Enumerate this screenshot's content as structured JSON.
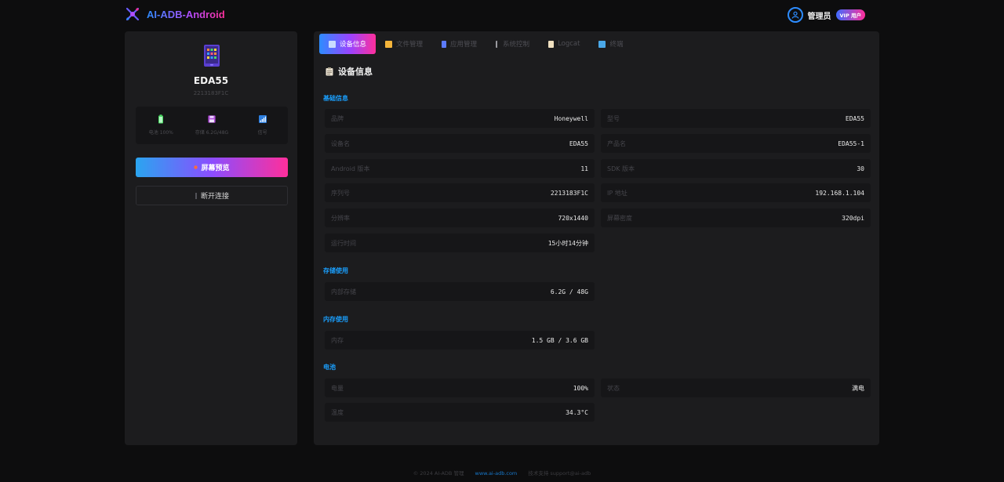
{
  "header": {
    "brand": "AI-ADB-Android",
    "user_name": "管理员",
    "vip_badge": "VIP 用户"
  },
  "device": {
    "name": "EDA55",
    "subtitle": "2213183F1C",
    "stats": [
      {
        "label": "电池 100%",
        "icon": "battery-icon",
        "color": "#4cd964"
      },
      {
        "label": "存储 6.2G/48G",
        "icon": "floppy-icon",
        "color": "#d37bff"
      },
      {
        "label": "信号",
        "icon": "signal-icon",
        "color": "#3aa0ff"
      }
    ],
    "preview_button": "屏幕预览",
    "disconnect_button": "断开连接"
  },
  "tabs": [
    {
      "label": "设备信息",
      "active": true,
      "icon_color": "#7fb6ff"
    },
    {
      "label": "文件管理",
      "active": false,
      "icon_color": "#f5b53b"
    },
    {
      "label": "应用管理",
      "active": false,
      "icon_color": "#5c7bff"
    },
    {
      "label": "系统控制",
      "active": false,
      "icon_color": "#bbbbbb"
    },
    {
      "label": "Logcat",
      "active": false,
      "icon_color": "#f0e0c0"
    },
    {
      "label": "终端",
      "active": false,
      "icon_color": "#4aa8e8"
    }
  ],
  "panel_title": "设备信息",
  "sections": {
    "basic": {
      "title": "基础信息",
      "rows": [
        {
          "key": "品牌",
          "value": "Honeywell"
        },
        {
          "key": "型号",
          "value": "EDA55"
        },
        {
          "key": "设备名",
          "value": "EDA55"
        },
        {
          "key": "产品名",
          "value": "EDA55-1"
        },
        {
          "key": "Android 版本",
          "value": "11"
        },
        {
          "key": "SDK 版本",
          "value": "30"
        },
        {
          "key": "序列号",
          "value": "2213183F1C"
        },
        {
          "key": "IP 地址",
          "value": "192.168.1.104"
        },
        {
          "key": "分辨率",
          "value": "720x1440"
        },
        {
          "key": "屏幕密度",
          "value": "320dpi"
        },
        {
          "key": "运行时间",
          "value": "15小时14分钟"
        }
      ]
    },
    "storage": {
      "title": "存储使用",
      "rows": [
        {
          "key": "内部存储",
          "value": "6.2G / 48G"
        }
      ]
    },
    "memory": {
      "title": "内存使用",
      "rows": [
        {
          "key": "内存",
          "value": "1.5 GB / 3.6 GB"
        }
      ]
    },
    "battery": {
      "title": "电池",
      "rows": [
        {
          "key": "电量",
          "value": "100%"
        },
        {
          "key": "状态",
          "value": "满电"
        },
        {
          "key": "温度",
          "value": "34.3°C"
        }
      ]
    }
  },
  "footer": {
    "copyright": "© 2024 AI-ADB 管理",
    "link": "www.ai-adb.com",
    "contact": "技术支持 support@ai-adb"
  }
}
